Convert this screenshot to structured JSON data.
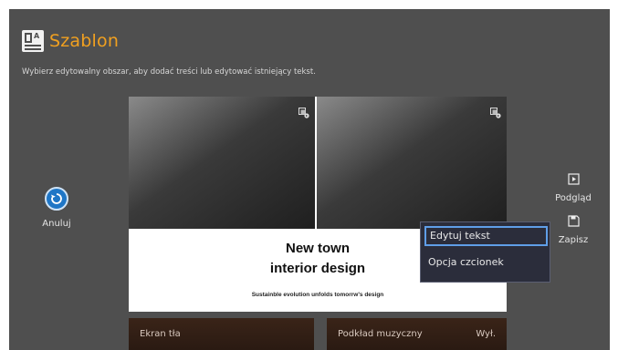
{
  "header": {
    "title": "Szablon",
    "subtitle": "Wybierz edytowalny obszar, aby dodać treści lub edytować istniejący tekst.",
    "icon": "template-icon"
  },
  "cancel": {
    "label": "Anuluj",
    "icon": "undo-circle-icon"
  },
  "canvas": {
    "title_line1": "New town",
    "title_line2": "interior design",
    "tagline": "Sustainble evolution unfolds tomorrw's design"
  },
  "bottom": {
    "background_label": "Ekran tła",
    "music_label": "Podkład muzyczny",
    "music_value": "Wył."
  },
  "side": {
    "preview_label": "Podgląd",
    "save_label": "Zapisz"
  },
  "context_menu": {
    "items": [
      "Edytuj tekst",
      "Opcja czcionek"
    ],
    "selected_index": 0
  },
  "colors": {
    "accent": "#f0a020",
    "background": "#4f4f4f",
    "cancel_blue": "#1f76c6",
    "menu_selection": "#5f9ee8"
  }
}
